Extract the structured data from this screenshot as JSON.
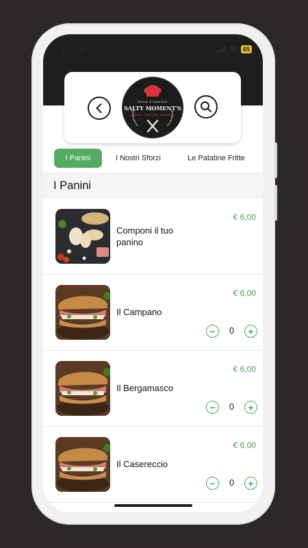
{
  "status_bar": {
    "time": "12:29",
    "battery": "65"
  },
  "header": {
    "back_icon": "chevron-left-icon",
    "search_icon": "search-icon",
    "logo": {
      "tagline": "ROSTA E MANGIA!",
      "name": "SALTY MOMENT'S",
      "sub": "pizzeria · girarrosto · paninificio"
    }
  },
  "tabs": [
    {
      "label": "I Panini",
      "active": true
    },
    {
      "label": "I Nostri Sforzi",
      "active": false
    },
    {
      "label": "Le Patatine Fritte",
      "active": false
    }
  ],
  "section": {
    "title": "I Panini"
  },
  "products": [
    {
      "name": "Componi il tuo panino",
      "price": "€ 6,00",
      "quantity": null
    },
    {
      "name": "Il Campano",
      "price": "€ 6,00",
      "quantity": "0"
    },
    {
      "name": "Il Bergamasco",
      "price": "€ 6,00",
      "quantity": "0"
    },
    {
      "name": "Il Casereccio",
      "price": "€ 6,00",
      "quantity": "0"
    }
  ],
  "colors": {
    "accent": "#56ab62",
    "price": "#48a45a",
    "status_bar": "#1e1e1e"
  }
}
